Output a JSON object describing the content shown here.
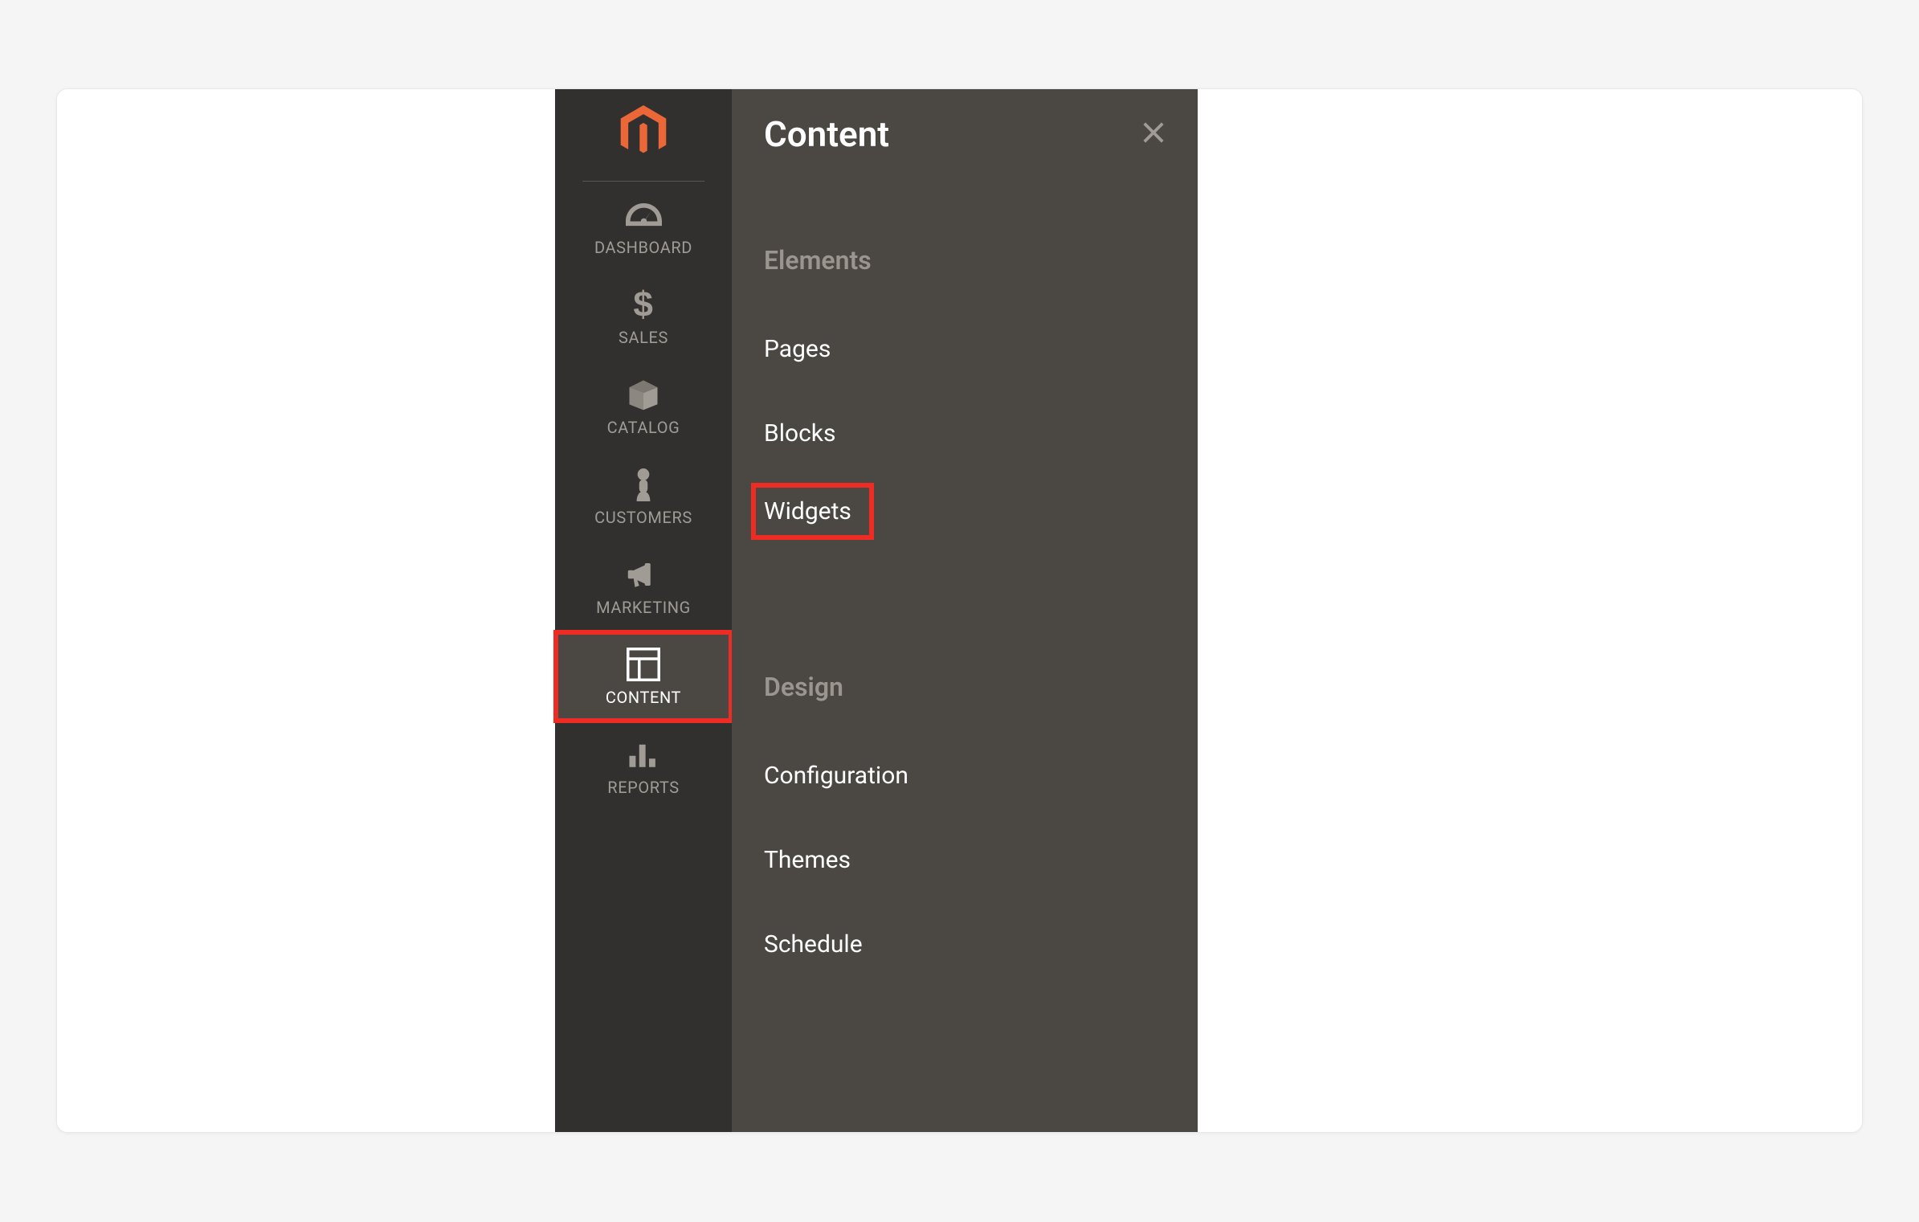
{
  "sidebar": {
    "items": [
      {
        "label": "DASHBOARD",
        "icon": "gauge-icon"
      },
      {
        "label": "SALES",
        "icon": "dollar-icon"
      },
      {
        "label": "CATALOG",
        "icon": "box-icon"
      },
      {
        "label": "CUSTOMERS",
        "icon": "person-icon"
      },
      {
        "label": "MARKETING",
        "icon": "megaphone-icon"
      },
      {
        "label": "CONTENT",
        "icon": "layout-icon"
      },
      {
        "label": "REPORTS",
        "icon": "bars-icon"
      }
    ]
  },
  "flyout": {
    "title": "Content",
    "sections": [
      {
        "title": "Elements",
        "items": [
          {
            "label": "Pages"
          },
          {
            "label": "Blocks"
          },
          {
            "label": "Widgets"
          }
        ]
      },
      {
        "title": "Design",
        "items": [
          {
            "label": "Configuration"
          },
          {
            "label": "Themes"
          },
          {
            "label": "Schedule"
          }
        ]
      }
    ]
  },
  "colors": {
    "highlight": "#ee2c24",
    "brand": "#ec6737"
  }
}
